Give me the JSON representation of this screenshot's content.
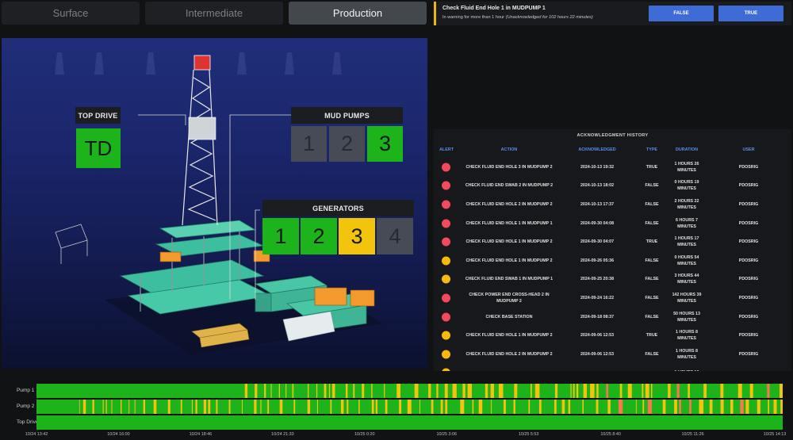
{
  "tabs": [
    {
      "label": "Surface",
      "active": false
    },
    {
      "label": "Intermediate",
      "active": false
    },
    {
      "label": "Production",
      "active": true
    }
  ],
  "rig": {
    "top_drive": {
      "label": "TOP DRIVE",
      "tile": "TD",
      "color": "#1db31a"
    },
    "mud_pumps": {
      "label": "MUD PUMPS",
      "tiles": [
        {
          "text": "1",
          "state": "gray"
        },
        {
          "text": "2",
          "state": "gray"
        },
        {
          "text": "3",
          "state": "green"
        }
      ]
    },
    "generators": {
      "label": "GENERATORS",
      "tiles": [
        {
          "text": "1",
          "state": "green"
        },
        {
          "text": "2",
          "state": "green"
        },
        {
          "text": "3",
          "state": "yellow"
        },
        {
          "text": "4",
          "state": "gray"
        }
      ]
    }
  },
  "alert": {
    "title": "Check Fluid End Hole 1 in MUDPUMP 1",
    "subtitle": "In warning for more than 1 hour",
    "subtitle_detail": "(Unacknowledged for 102 hours 22 minutes)",
    "accent": "#e8b80a",
    "buttons": {
      "false_label": "FALSE",
      "true_label": "TRUE"
    }
  },
  "ack_history": {
    "title": "ACKNOWLEDGMENT HISTORY",
    "columns": {
      "alert": "ALERT",
      "action": "ACTION",
      "acknowledged": "ACKNOWLEDGED",
      "type": "TYPE",
      "duration": "DURATION",
      "user": "USER"
    },
    "rows": [
      {
        "status": "red",
        "action": "CHECK FLUID END HOLE 3 IN MUDPUMP 2",
        "acknowledged": "2024-10-13 19:32",
        "type": "TRUE",
        "duration": "1 HOURS 26 MINUTES",
        "user": "PDOSRIG"
      },
      {
        "status": "red",
        "action": "CHECK FLUID END SWAB 2 IN MUDPUMP 2",
        "acknowledged": "2024-10-13 18:02",
        "type": "FALSE",
        "duration": "0 HOURS 19 MINUTES",
        "user": "PDOSRIG"
      },
      {
        "status": "red",
        "action": "CHECK FLUID END HOLE 2 IN MUDPUMP 2",
        "acknowledged": "2024-10-13 17:37",
        "type": "FALSE",
        "duration": "2 HOURS 22 MINUTES",
        "user": "PDOSRIG"
      },
      {
        "status": "red",
        "action": "CHECK FLUID END HOLE 1 IN MUDPUMP 1",
        "acknowledged": "2024-09-30 04:08",
        "type": "FALSE",
        "duration": "6 HOURS 7 MINUTES",
        "user": "PDOSRIG"
      },
      {
        "status": "red",
        "action": "CHECK FLUID END HOLE 1 IN MUDPUMP 2",
        "acknowledged": "2024-09-30 04:07",
        "type": "TRUE",
        "duration": "1 HOURS 17 MINUTES",
        "user": "PDOSRIG"
      },
      {
        "status": "yellow",
        "action": "CHECK FLUID END HOLE 1 IN MUDPUMP 2",
        "acknowledged": "2024-09-26 05:36",
        "type": "FALSE",
        "duration": "0 HOURS 54 MINUTES",
        "user": "PDOSRIG"
      },
      {
        "status": "yellow",
        "action": "CHECK FLUID END SWAB 1 IN MUDPUMP 1",
        "acknowledged": "2024-09-25 20:38",
        "type": "FALSE",
        "duration": "3 HOURS 44 MINUTES",
        "user": "PDOSRIG"
      },
      {
        "status": "red",
        "action": "CHECK POWER END CROSS-HEAD 2 IN MUDPUMP 2",
        "acknowledged": "2024-09-24 16:22",
        "type": "FALSE",
        "duration": "142 HOURS 39 MINUTES",
        "user": "PDOSRIG"
      },
      {
        "status": "red",
        "action": "CHECK BASE STATION",
        "acknowledged": "2024-09-18 08:37",
        "type": "FALSE",
        "duration": "50 HOURS 13 MINUTES",
        "user": "PDOSRIG"
      },
      {
        "status": "yellow",
        "action": "CHECK FLUID END HOLE 1 IN MUDPUMP 2",
        "acknowledged": "2024-09-06 12:53",
        "type": "TRUE",
        "duration": "1 HOURS 8 MINUTES",
        "user": "PDOSRIG"
      },
      {
        "status": "yellow",
        "action": "CHECK FLUID END HOLE 2 IN MUDPUMP 2",
        "acknowledged": "2024-09-06 12:53",
        "type": "FALSE",
        "duration": "1 HOURS 8 MINUTES",
        "user": "PDOSRIG"
      },
      {
        "status": "yellow",
        "action": "",
        "acknowledged": "",
        "type": "",
        "duration": "1 HOURS 10",
        "user": ""
      }
    ]
  },
  "timeline": {
    "rows": [
      "Pump 1",
      "Pump 2",
      "Top Drive"
    ],
    "colors": {
      "ok": "#1db31a",
      "warn": "#f2c40c",
      "alarm": "#f27a4d"
    },
    "ticks": [
      "10/24 13:42",
      "10/24 16:00",
      "10/24 18:46",
      "10/24 21:33",
      "10/25 0:20",
      "10/25 3:06",
      "10/25 5:53",
      "10/25 8:40",
      "10/25 11:26",
      "10/25 14:13"
    ]
  }
}
